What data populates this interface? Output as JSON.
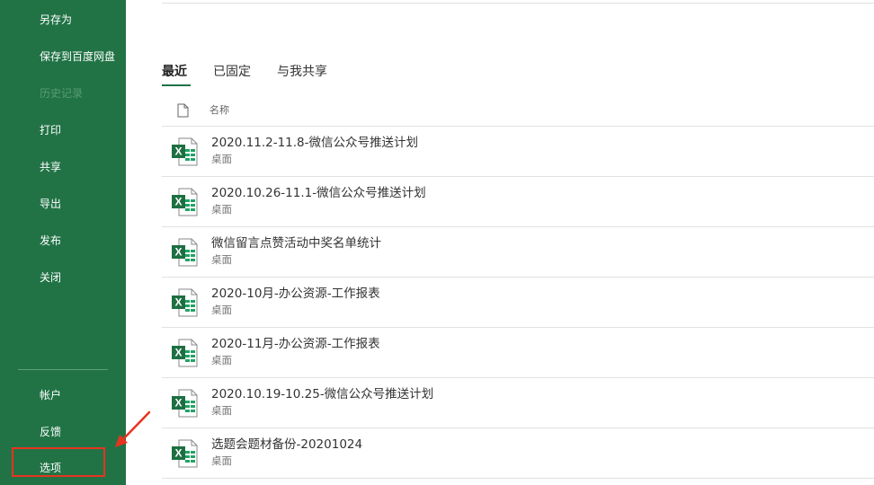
{
  "sidebar": {
    "items": [
      {
        "label": "另存为",
        "enabled": true
      },
      {
        "label": "保存到百度网盘",
        "enabled": true
      },
      {
        "label": "历史记录",
        "enabled": false
      },
      {
        "label": "打印",
        "enabled": true
      },
      {
        "label": "共享",
        "enabled": true
      },
      {
        "label": "导出",
        "enabled": true
      },
      {
        "label": "发布",
        "enabled": true
      },
      {
        "label": "关闭",
        "enabled": true
      }
    ],
    "bottom_items": [
      {
        "label": "帐户"
      },
      {
        "label": "反馈"
      },
      {
        "label": "选项"
      }
    ],
    "highlighted_item": "选项"
  },
  "tabs": [
    {
      "label": "最近",
      "active": true
    },
    {
      "label": "已固定",
      "active": false
    },
    {
      "label": "与我共享",
      "active": false
    }
  ],
  "file_list": {
    "header_label": "名称",
    "items": [
      {
        "name": "2020.11.2-11.8-微信公众号推送计划",
        "location": "桌面",
        "icon": "excel-file-icon"
      },
      {
        "name": "2020.10.26-11.1-微信公众号推送计划",
        "location": "桌面",
        "icon": "excel-file-icon"
      },
      {
        "name": "微信留言点赞活动中奖名单统计",
        "location": "桌面",
        "icon": "excel-file-icon"
      },
      {
        "name": "2020-10月-办公资源-工作报表",
        "location": "桌面",
        "icon": "excel-file-icon"
      },
      {
        "name": "2020-11月-办公资源-工作报表",
        "location": "桌面",
        "icon": "excel-file-icon"
      },
      {
        "name": "2020.10.19-10.25-微信公众号推送计划",
        "location": "桌面",
        "icon": "excel-file-icon"
      },
      {
        "name": "选题会题材备份-20201024",
        "location": "桌面",
        "icon": "excel-file-icon"
      }
    ]
  },
  "colors": {
    "sidebar_bg": "#217346",
    "accent_green": "#217346",
    "highlight_red": "#e8331f"
  }
}
